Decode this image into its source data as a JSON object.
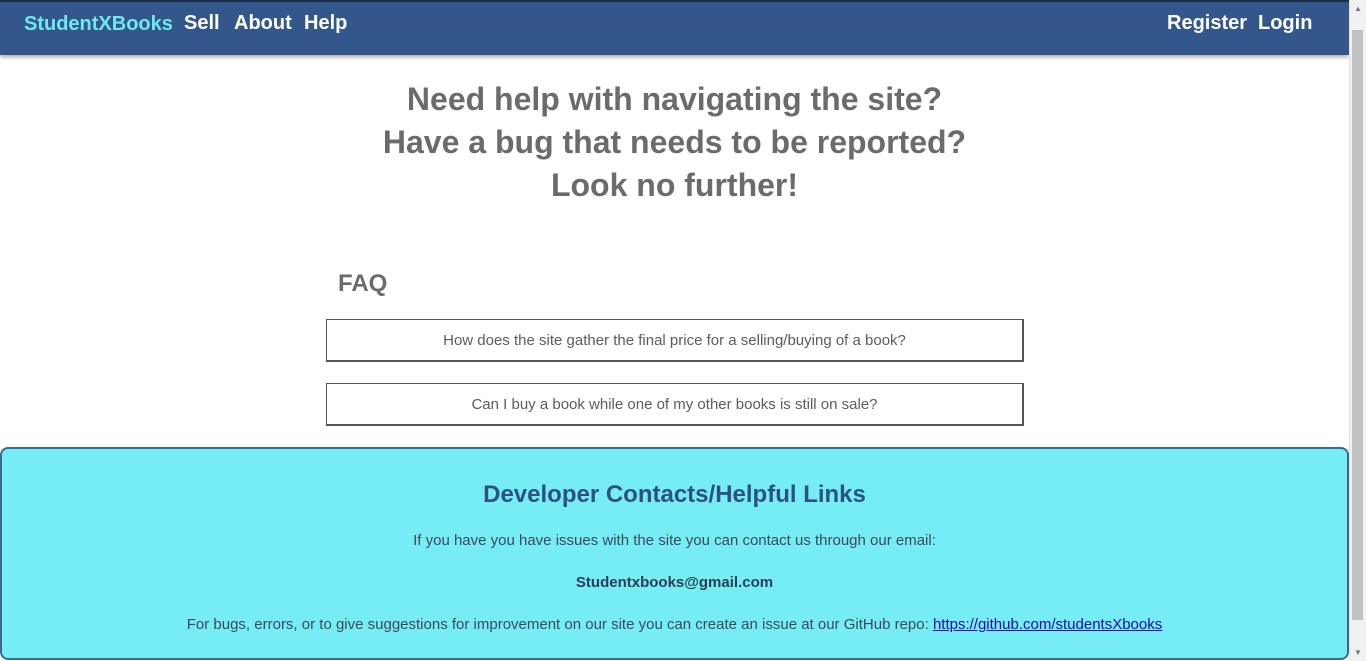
{
  "nav": {
    "brand": "StudentXBooks",
    "links": [
      "Sell",
      "About",
      "Help"
    ],
    "register": "Register",
    "login": "Login"
  },
  "hero": {
    "lines": [
      "Need help with navigating the site?",
      "Have a bug that needs to be reported?",
      "Look no further!"
    ]
  },
  "faq": {
    "title": "FAQ",
    "items": [
      "How does the site gather the final price for a selling/buying of a book?",
      "Can I buy a book while one of my other books is still on sale?"
    ]
  },
  "footer": {
    "title": "Developer Contacts/Helpful Links",
    "contact_text": "If you have you have issues with the site you can contact us through our email:",
    "email": "Studentxbooks@gmail.com",
    "bugs_text": "For bugs, errors, or to give suggestions for improvement on our site you can create an issue at our GitHub repo:",
    "repo_url": "https://github.com/studentsXbooks"
  },
  "colors": {
    "navbar": "#34578b",
    "brand": "#6ee7f5",
    "footer_bg": "#76ecf5",
    "footer_title": "#2c5282",
    "heading_gray": "#6b6b6b"
  },
  "icons": {
    "scroll_up": "triangle-up",
    "scroll_down": "triangle-down"
  }
}
